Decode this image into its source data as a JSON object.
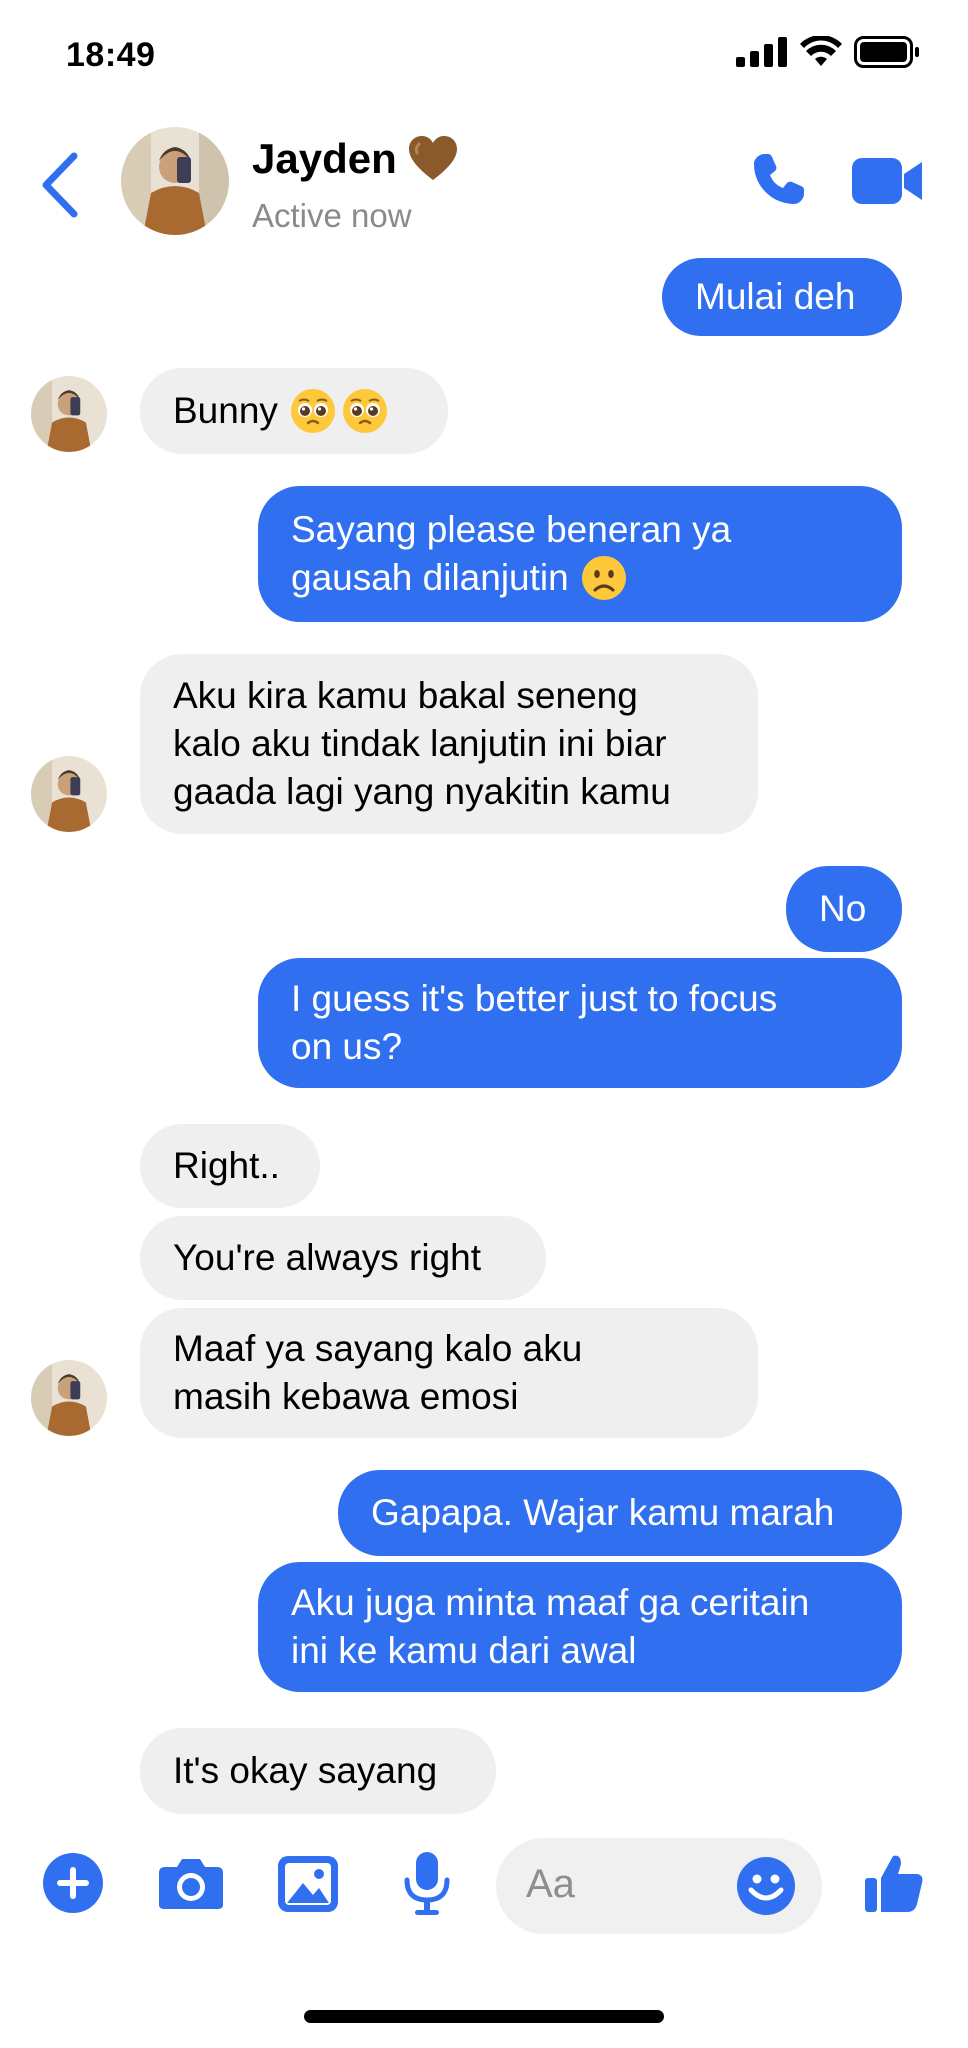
{
  "status": {
    "time": "18:49"
  },
  "header": {
    "name": "Jayden",
    "name_emoji": "brown-heart",
    "status": "Active now"
  },
  "messages": [
    {
      "dir": "out",
      "lines": [
        "Mulai deh"
      ]
    },
    {
      "dir": "in",
      "lines": [
        "Bunny"
      ],
      "emojis": [
        "pleading-face",
        "pleading-face"
      ]
    },
    {
      "dir": "out",
      "lines": [
        "Sayang please beneran ya",
        "gausah dilanjutin"
      ],
      "emojis": [
        "frowning-face"
      ]
    },
    {
      "dir": "in",
      "lines": [
        "Aku kira kamu bakal seneng",
        "kalo aku tindak lanjutin ini biar",
        "gaada lagi yang nyakitin kamu"
      ]
    },
    {
      "dir": "out",
      "lines": [
        "No"
      ]
    },
    {
      "dir": "out",
      "lines": [
        "I guess it's better just to focus",
        "on us?"
      ]
    },
    {
      "dir": "in",
      "lines": [
        "Right.."
      ]
    },
    {
      "dir": "in",
      "lines": [
        "You're always right"
      ]
    },
    {
      "dir": "in",
      "lines": [
        "Maaf ya sayang kalo aku",
        "masih kebawa emosi"
      ]
    },
    {
      "dir": "out",
      "lines": [
        "Gapapa. Wajar kamu marah"
      ]
    },
    {
      "dir": "out",
      "lines": [
        "Aku juga minta maaf ga ceritain",
        "ini ke kamu dari awal"
      ]
    },
    {
      "dir": "in",
      "lines": [
        "It's okay sayang"
      ]
    }
  ],
  "composer": {
    "placeholder": "Aa"
  },
  "toolbar_icons": [
    "plus-icon",
    "camera-icon",
    "gallery-icon",
    "microphone-icon",
    "emoji-icon",
    "thumbs-up-icon"
  ],
  "colors": {
    "accent": "#2f6ff0",
    "incoming_bg": "#efefef",
    "secondary_text": "#8a8a8e"
  }
}
